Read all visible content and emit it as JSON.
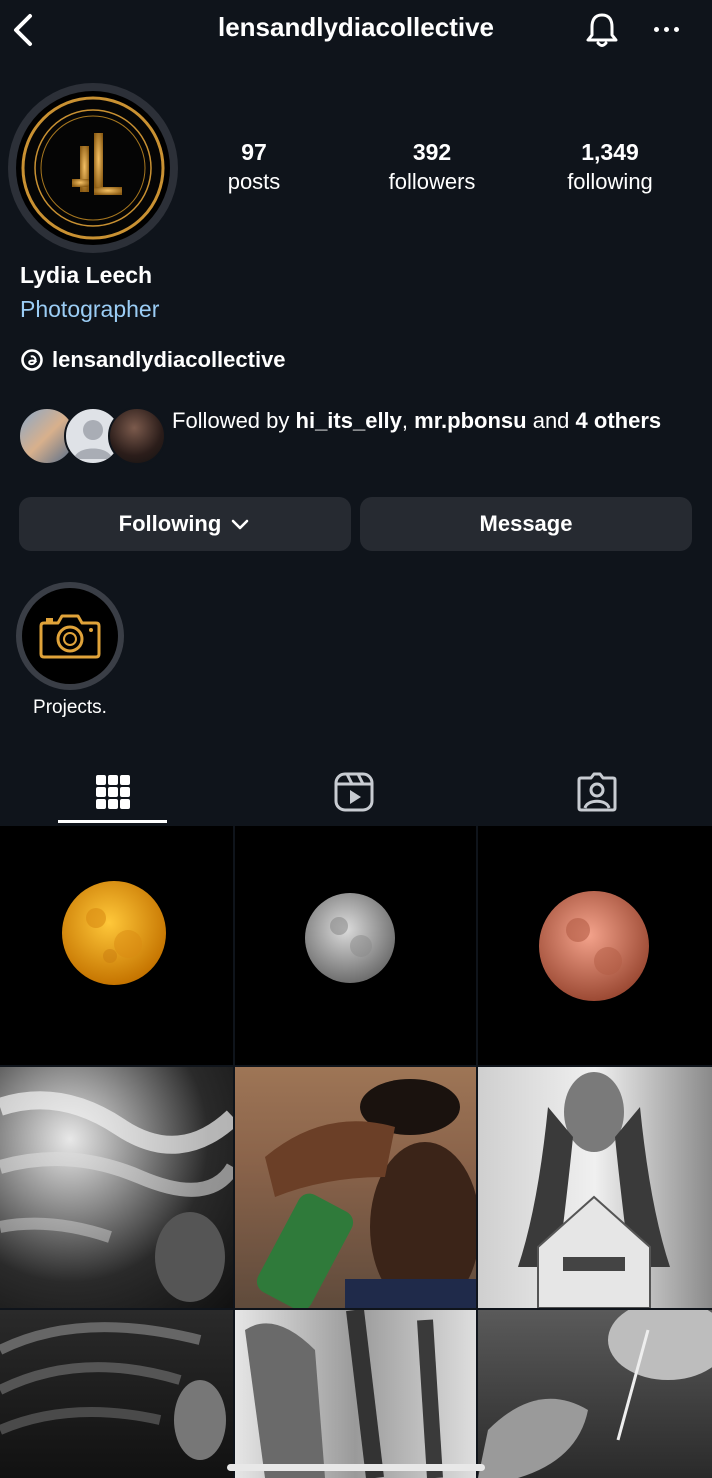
{
  "header": {
    "username": "lensandlydiacollective",
    "back_icon": "chevron-left-icon",
    "bell_icon": "bell-icon",
    "more_icon": "more-horizontal-icon"
  },
  "profile": {
    "posts_count": "97",
    "posts_label": "posts",
    "followers_count": "392",
    "followers_label": "followers",
    "following_count": "1,349",
    "following_label": "following",
    "name": "Lydia Leech",
    "category": "Photographer",
    "threads_handle": "lensandlydiacollective",
    "followed_by": {
      "prefix": "Followed by ",
      "user1": "hi_its_elly",
      "sep": ", ",
      "user2": "mr.pbonsu",
      "mid": " and ",
      "others": "4 others"
    }
  },
  "actions": {
    "following_label": "Following",
    "message_label": "Message"
  },
  "highlights": [
    {
      "label": "Projects."
    }
  ],
  "tabs": [
    {
      "name": "posts-grid",
      "icon": "grid-icon",
      "selected": true
    },
    {
      "name": "reels",
      "icon": "reels-icon",
      "selected": false
    },
    {
      "name": "tagged",
      "icon": "tagged-person-icon",
      "selected": false
    }
  ],
  "colors": {
    "background": "#0f141b",
    "button": "#262a31",
    "category": "#9bcdf5",
    "brand_gold": "#d4921a"
  }
}
